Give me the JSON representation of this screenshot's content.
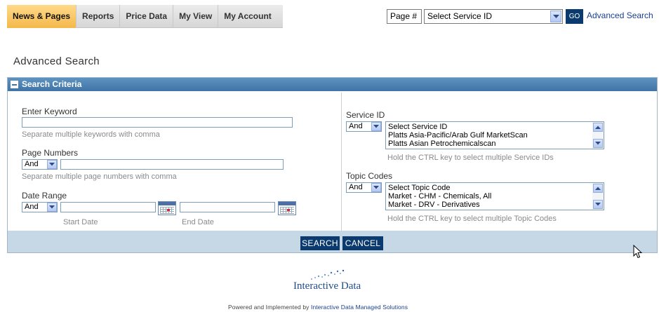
{
  "nav": {
    "tabs": [
      {
        "label": "News & Pages",
        "active": true
      },
      {
        "label": "Reports",
        "active": false
      },
      {
        "label": "Price Data",
        "active": false
      },
      {
        "label": "My View",
        "active": false
      },
      {
        "label": "My Account",
        "active": false
      }
    ]
  },
  "header_tools": {
    "page_button": "Page #",
    "service_select": "Select Service ID",
    "go_button": "GO",
    "advanced_link": "Advanced Search"
  },
  "page_title": "Advanced Search",
  "panel": {
    "title": "Search Criteria",
    "keyword": {
      "label": "Enter Keyword",
      "value": "",
      "hint": "Separate multiple keywords with comma"
    },
    "page_numbers": {
      "label": "Page Numbers",
      "operator": "And",
      "value": "",
      "hint": "Separate multiple page numbers with comma"
    },
    "date_range": {
      "label": "Date Range",
      "operator": "And",
      "start_value": "",
      "end_value": "",
      "start_label": "Start Date",
      "end_label": "End Date"
    },
    "service_id": {
      "label": "Service ID",
      "operator": "And",
      "options": [
        "Select Service ID",
        "Platts Asia-Pacific/Arab Gulf MarketScan",
        "Platts Asian Petrochemicalscan"
      ],
      "hint": "Hold the CTRL key to select multiple Service IDs"
    },
    "topic_codes": {
      "label": "Topic Codes",
      "operator": "And",
      "options": [
        "Select Topic Code",
        "Market - CHM - Chemicals, All",
        "Market - DRV - Derivatives"
      ],
      "hint": "Hold the CTRL key to select multiple Topic Codes"
    },
    "search_button": "SEARCH",
    "cancel_button": "CANCEL"
  },
  "footer": {
    "logo_text": "Interactive Data",
    "powered_prefix": "Powered and Implemented by ",
    "powered_link": "Interactive Data Managed Solutions"
  },
  "colors": {
    "active_tab": "#f4b94a",
    "panel_header": "#3f74a6",
    "button_navy": "#0b3a6e",
    "footer_band": "#c6d7e6",
    "link": "#1a3f8f"
  }
}
